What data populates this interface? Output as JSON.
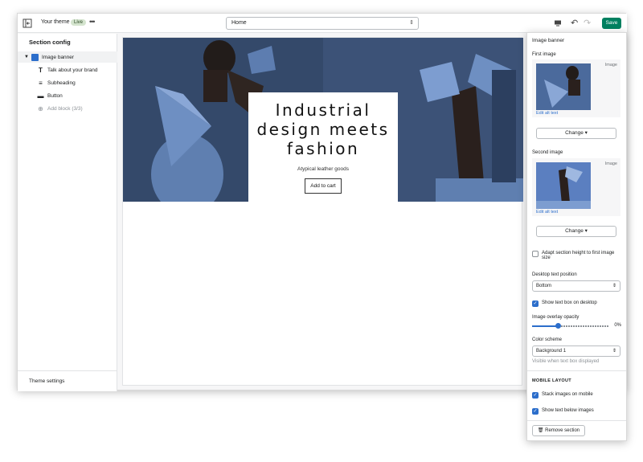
{
  "topbar": {
    "theme_name": "Your theme",
    "status_badge": "Live",
    "page_select": "Home",
    "save_label": "Save"
  },
  "sidebar": {
    "title": "Section config",
    "section": "Image banner",
    "blocks": [
      "Talk about your brand",
      "Subheading",
      "Button"
    ],
    "add_block": "Add block (3/3)",
    "theme_settings": "Theme settings"
  },
  "banner": {
    "heading": "Industrial design meets fashion",
    "subheading": "Atypical leather goods",
    "button": "Add to cart"
  },
  "settings": {
    "title": "Image banner",
    "first_image_label": "First image",
    "second_image_label": "Second image",
    "image_tag": "Image",
    "edit_alt": "Edit alt text",
    "change": "Change",
    "adapt_height": "Adapt section height to first image size",
    "adapt_height_checked": false,
    "desktop_text_position_label": "Desktop text position",
    "desktop_text_position": "Bottom",
    "show_text_box": "Show text box on desktop",
    "show_text_box_checked": true,
    "overlay_label": "Image overlay opacity",
    "overlay_value": "0%",
    "color_scheme_label": "Color scheme",
    "color_scheme": "Background 1",
    "color_scheme_help": "Visible when text box displayed",
    "mobile_layout": "MOBILE LAYOUT",
    "stack_images": "Stack images on mobile",
    "stack_images_checked": true,
    "text_below": "Show text below images",
    "text_below_checked": true,
    "remove": "Remove section"
  },
  "colors": {
    "save_green": "#008060",
    "accent_blue": "#2c6ecb",
    "banner_navy": "#3a4f6e"
  }
}
